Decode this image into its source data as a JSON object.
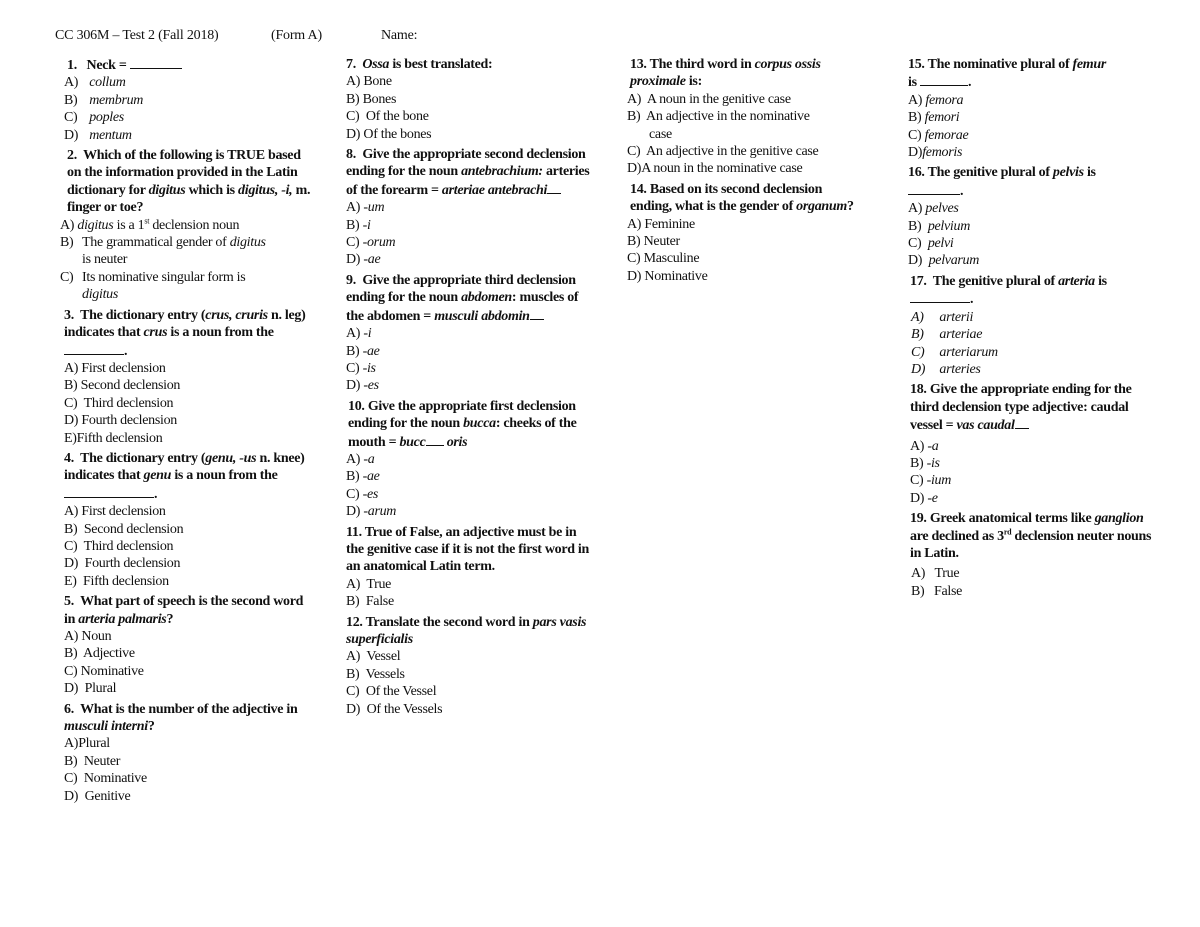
{
  "header": {
    "course": "CC 306M – Test 2 (Fall 2018)",
    "form": "(Form A)",
    "name_label": "Name:"
  },
  "questions": [
    {
      "num": "1.",
      "text_parts": [
        "Neck = "
      ],
      "options": [
        {
          "l": "A)",
          "t": "collum"
        },
        {
          "l": "B)",
          "t": "membrum"
        },
        {
          "l": "C)",
          "t": "poples"
        },
        {
          "l": "D)",
          "t": "mentum"
        }
      ]
    },
    {
      "num": "2.",
      "text": "Which of the following is TRUE based on the information provided in the Latin dictionary for",
      "latin1": "digitus",
      "text2": "which is",
      "latin2": "digitus, -i,",
      "text3": "m. finger or toe?",
      "options": [
        {
          "l": "A)",
          "latin": "digitus",
          "t": "is a 1",
          "sup": "st",
          "t2": "declension noun"
        },
        {
          "l": "B)",
          "t": "The grammatical gender of",
          "latin": "digitus",
          "t2": "is neuter"
        },
        {
          "l": "C)",
          "t": "Its nominative singular form is",
          "latin": "digitus"
        }
      ]
    },
    {
      "num": "3.",
      "text": "The dictionary entry (",
      "latin1": "crus, cruris",
      "text2": "n. leg) indicates that",
      "latin2": "crus",
      "text3": "is a noun from the",
      "options": [
        {
          "l": "A)",
          "t": "First declension"
        },
        {
          "l": "B)",
          "t": "Second declension"
        },
        {
          "l": "C)",
          "t": "Third declension"
        },
        {
          "l": "D)",
          "t": "Fourth declension"
        },
        {
          "l": "E)",
          "t": "Fifth declension"
        }
      ]
    },
    {
      "num": "4.",
      "text": "The dictionary entry (",
      "latin1": "genu, -us",
      "text2": "n. knee) indicates that",
      "latin2": "genu",
      "text3": "is a noun from the",
      "options": [
        {
          "l": "A)",
          "t": "First declension"
        },
        {
          "l": "B)",
          "t": "Second declension"
        },
        {
          "l": "C)",
          "t": "Third declension"
        },
        {
          "l": "D)",
          "t": "Fourth declension"
        },
        {
          "l": "E)",
          "t": "Fifth declension"
        }
      ]
    },
    {
      "num": "5.",
      "text": "What part of speech is the second word in",
      "latin1": "arteria palmaris",
      "text2": "?",
      "options": [
        {
          "l": "A)",
          "t": "Noun"
        },
        {
          "l": "B)",
          "t": "Adjective"
        },
        {
          "l": "C)",
          "t": "Nominative"
        },
        {
          "l": "D)",
          "t": "Plural"
        }
      ]
    },
    {
      "num": "6.",
      "text": "What is the number of the adjective in",
      "latin1": "musculi interni",
      "text2": "?",
      "options": [
        {
          "l": "A)",
          "t": "Plural"
        },
        {
          "l": "B)",
          "t": "Neuter"
        },
        {
          "l": "C)",
          "t": "Nominative"
        },
        {
          "l": "D)",
          "t": "Genitive"
        }
      ]
    },
    {
      "num": "7.",
      "latin1": "Ossa",
      "text2": "is best translated:",
      "options": [
        {
          "l": "A)",
          "t": "Bone"
        },
        {
          "l": "B)",
          "t": "Bones"
        },
        {
          "l": "C)",
          "t": "Of the bone"
        },
        {
          "l": "D)",
          "t": "Of the bones"
        }
      ]
    },
    {
      "num": "8.",
      "text": "Give the appropriate second declension ending for the noun",
      "latin1": "antebrachium:",
      "text2": "arteries of the forearm =",
      "latin2": "arteriae antebrachi",
      "options": [
        {
          "l": "A)",
          "t": "-um"
        },
        {
          "l": "B)",
          "t": "-i"
        },
        {
          "l": "C)",
          "t": "-orum"
        },
        {
          "l": "D)",
          "t": "-ae"
        }
      ]
    },
    {
      "num": "9.",
      "text": "Give the appropriate third declension ending for the noun",
      "latin1": "abdomen",
      "text2": ": muscles of the abdomen =",
      "latin2": "musculi abdomin",
      "options": [
        {
          "l": "A)",
          "t": "-i"
        },
        {
          "l": "B)",
          "t": "-ae"
        },
        {
          "l": "C)",
          "t": "-is"
        },
        {
          "l": "D)",
          "t": "-es"
        }
      ]
    },
    {
      "num": "10.",
      "text": "Give the appropriate first declension ending for the noun",
      "latin1": "bucca",
      "text2": ": cheeks of the mouth =",
      "latin2": "bucc",
      "latin3": "oris",
      "options": [
        {
          "l": "A)",
          "t": "-a"
        },
        {
          "l": "B)",
          "t": "-ae"
        },
        {
          "l": "C)",
          "t": "-es"
        },
        {
          "l": "D)",
          "t": "-arum"
        }
      ]
    },
    {
      "num": "11.",
      "text": "True of False, an adjective must be in the genitive case if it is not the first word in an anatomical Latin term.",
      "options": [
        {
          "l": "A)",
          "t": "True"
        },
        {
          "l": "B)",
          "t": "False"
        }
      ]
    },
    {
      "num": "12.",
      "text": "Translate the second word in",
      "latin1": "pars vasis superficialis",
      "options": [
        {
          "l": "A)",
          "t": "Vessel"
        },
        {
          "l": "B)",
          "t": "Vessels"
        },
        {
          "l": "C)",
          "t": "Of the Vessel"
        },
        {
          "l": "D)",
          "t": "Of the Vessels"
        }
      ]
    },
    {
      "num": "13.",
      "text": "The third word in",
      "latin1": "corpus ossis proximale",
      "text2": "is:",
      "options": [
        {
          "l": "A)",
          "t": "A noun in the genitive case"
        },
        {
          "l": "B)",
          "t": "An adjective in the nominative",
          "t2": "case"
        },
        {
          "l": "C)",
          "t": "An adjective in the genitive case"
        },
        {
          "l": "D)",
          "t": "A noun in the nominative case"
        }
      ]
    },
    {
      "num": "14.",
      "text": "Based on its second declension ending, what is the gender of",
      "latin1": "organum",
      "text2": "?",
      "options": [
        {
          "l": "A)",
          "t": "Feminine"
        },
        {
          "l": "B)",
          "t": "Neuter"
        },
        {
          "l": "C)",
          "t": "Masculine"
        },
        {
          "l": "D)",
          "t": "Nominative"
        }
      ]
    },
    {
      "num": "15.",
      "text": "The nominative plural of",
      "latin1": "femur",
      "text2": "is",
      "options": [
        {
          "l": "A)",
          "t": "femora"
        },
        {
          "l": "B)",
          "t": "femori"
        },
        {
          "l": "C)",
          "t": "femorae"
        },
        {
          "l": "D)",
          "t": "femoris"
        }
      ]
    },
    {
      "num": "16.",
      "text": "The genitive plural of",
      "latin1": "pelvis",
      "text2": "is",
      "options": [
        {
          "l": "A)",
          "t": "pelves"
        },
        {
          "l": "B)",
          "t": "pelvium"
        },
        {
          "l": "C)",
          "t": "pelvi"
        },
        {
          "l": "D)",
          "t": "pelvarum"
        }
      ]
    },
    {
      "num": "17.",
      "text": "The genitive plural of",
      "latin1": "arteria",
      "text2": "is",
      "options": [
        {
          "l": "A)",
          "t": "arterii"
        },
        {
          "l": "B)",
          "t": "arteriae"
        },
        {
          "l": "C)",
          "t": "arteriarum"
        },
        {
          "l": "D)",
          "t": "arteries"
        }
      ]
    },
    {
      "num": "18.",
      "text": "Give the appropriate ending for the third declension type adjective: caudal vessel =",
      "latin1": "vas caudal",
      "options": [
        {
          "l": "A)",
          "t": "-a"
        },
        {
          "l": "B)",
          "t": "-is"
        },
        {
          "l": "C)",
          "t": "-ium"
        },
        {
          "l": "D)",
          "t": "-e"
        }
      ]
    },
    {
      "num": "19.",
      "text": "Greek anatomical terms like",
      "latin1": "ganglion",
      "text2": "are declined as 3",
      "sup": "rd",
      "text3": "declension neuter nouns in Latin.",
      "options": [
        {
          "l": "A)",
          "t": "True"
        },
        {
          "l": "B)",
          "t": "False"
        }
      ]
    }
  ]
}
